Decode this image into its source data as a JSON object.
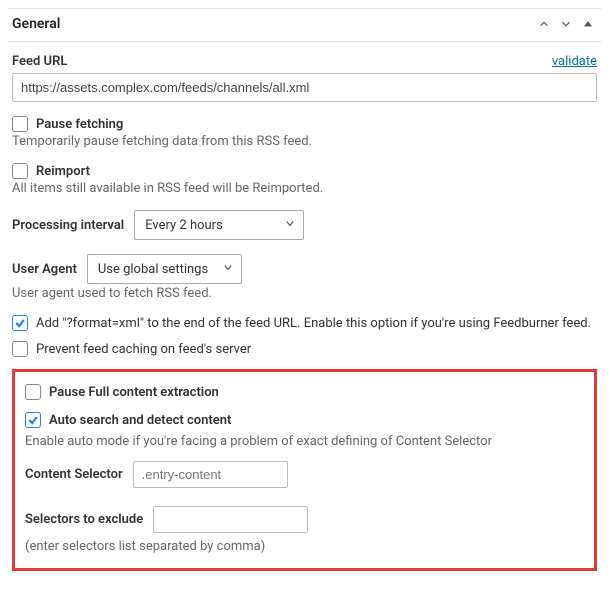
{
  "panel": {
    "title": "General"
  },
  "feed_url": {
    "label": "Feed URL",
    "validate_link": "validate",
    "value": "https://assets.complex.com/feeds/channels/all.xml"
  },
  "pause_fetching": {
    "label": "Pause fetching",
    "help": "Temporarily pause fetching data from this RSS feed.",
    "checked": false
  },
  "reimport": {
    "label": "Reimport",
    "help": "All items still available in RSS feed will be Reimported.",
    "checked": false
  },
  "processing_interval": {
    "label": "Processing interval",
    "value": "Every 2 hours"
  },
  "user_agent": {
    "label": "User Agent",
    "value": "Use global settings",
    "help": "User agent used to fetch RSS feed."
  },
  "add_format_xml": {
    "label": "Add \"?format=xml\" to the end of the feed URL. Enable this option if you're using Feedburner feed.",
    "checked": true
  },
  "prevent_caching": {
    "label": "Prevent feed caching on feed's server",
    "checked": false
  },
  "pause_full_content": {
    "label": "Pause Full content extraction",
    "checked": false
  },
  "auto_search": {
    "label": "Auto search and detect content",
    "help": "Enable auto mode if you're facing a problem of exact defining of Content Selector",
    "checked": true
  },
  "content_selector": {
    "label": "Content Selector",
    "placeholder": ".entry-content",
    "value": ""
  },
  "selectors_exclude": {
    "label": "Selectors to exclude",
    "value": "",
    "help": "(enter selectors list separated by comma)"
  }
}
